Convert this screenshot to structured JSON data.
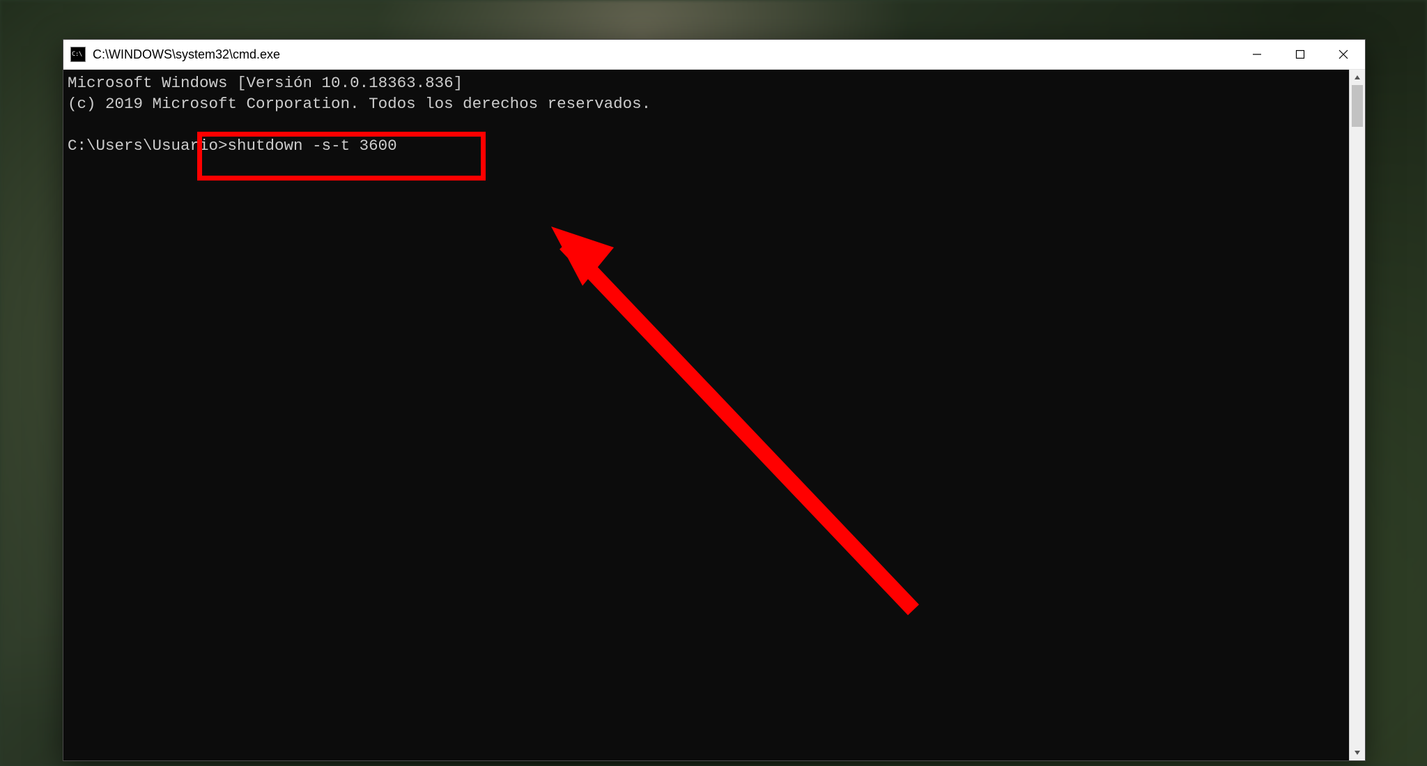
{
  "window": {
    "title": "C:\\WINDOWS\\system32\\cmd.exe"
  },
  "console": {
    "line1": "Microsoft Windows [Versión 10.0.18363.836]",
    "line2": "(c) 2019 Microsoft Corporation. Todos los derechos reservados.",
    "blank": "",
    "prompt_path": "C:\\Users\\Usuario>",
    "command": "shutdown -s-t 3600"
  },
  "annotation": {
    "highlight_target": "command",
    "color": "#ff0000"
  }
}
